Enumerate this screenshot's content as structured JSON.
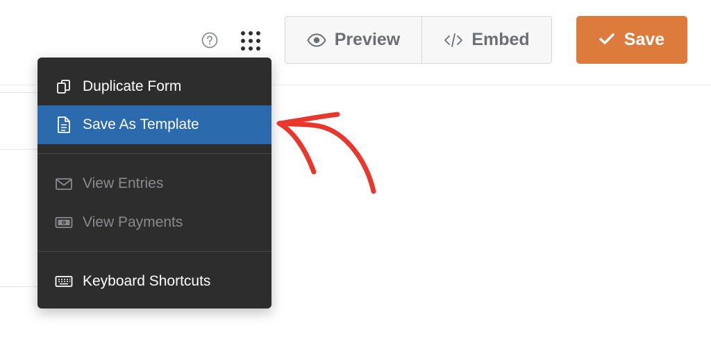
{
  "toolbar": {
    "help_icon": "question-circle-icon",
    "apps_icon": "grid-dots-icon",
    "preview_label": "Preview",
    "embed_label": "Embed",
    "save_label": "Save"
  },
  "menu": {
    "items": [
      {
        "label": "Duplicate Form",
        "icon": "duplicate-icon",
        "state": "normal"
      },
      {
        "label": "Save As Template",
        "icon": "document-icon",
        "state": "active"
      },
      {
        "label": "View Entries",
        "icon": "envelope-icon",
        "state": "disabled"
      },
      {
        "label": "View Payments",
        "icon": "money-icon",
        "state": "disabled"
      },
      {
        "label": "Keyboard Shortcuts",
        "icon": "keyboard-icon",
        "state": "normal"
      }
    ]
  },
  "colors": {
    "accent_orange": "#dd7b3c",
    "menu_bg": "#2d2d2e",
    "menu_active": "#2b6aac",
    "annotation_red": "#e8372c"
  }
}
